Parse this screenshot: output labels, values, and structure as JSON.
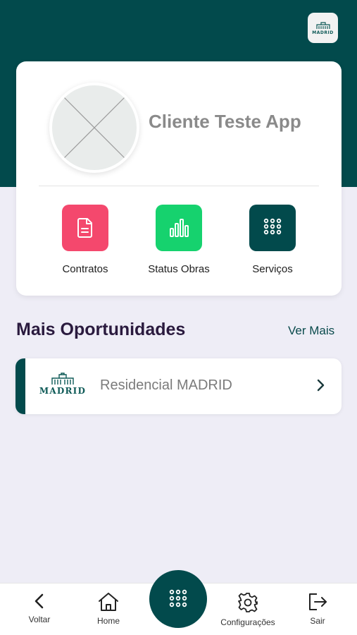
{
  "header": {
    "logo_text": "MADRID"
  },
  "profile": {
    "name": "Cliente Teste App"
  },
  "shortcuts": [
    {
      "label": "Contratos",
      "icon": "document-icon",
      "color": "#f4486d"
    },
    {
      "label": "Status Obras",
      "icon": "bar-chart-icon",
      "color": "#16d26e"
    },
    {
      "label": "Serviços",
      "icon": "grid-dots-icon",
      "color": "#024a4c"
    }
  ],
  "opportunities": {
    "title": "Mais Oportunidades",
    "see_more": "Ver Mais",
    "items": [
      {
        "logo_text": "MADRID",
        "name": "Residencial MADRID"
      }
    ]
  },
  "bottom_nav": {
    "items": [
      {
        "label": "Voltar",
        "icon": "chevron-left-icon"
      },
      {
        "label": "Home",
        "icon": "home-icon"
      },
      {
        "label": "",
        "icon": "grid-dots-icon"
      },
      {
        "label": "Configurações",
        "icon": "gear-icon"
      },
      {
        "label": "Sair",
        "icon": "logout-icon"
      }
    ]
  },
  "colors": {
    "primary": "#024a4c",
    "background": "#eeedf6",
    "contracts": "#f4486d",
    "status": "#16d26e"
  }
}
